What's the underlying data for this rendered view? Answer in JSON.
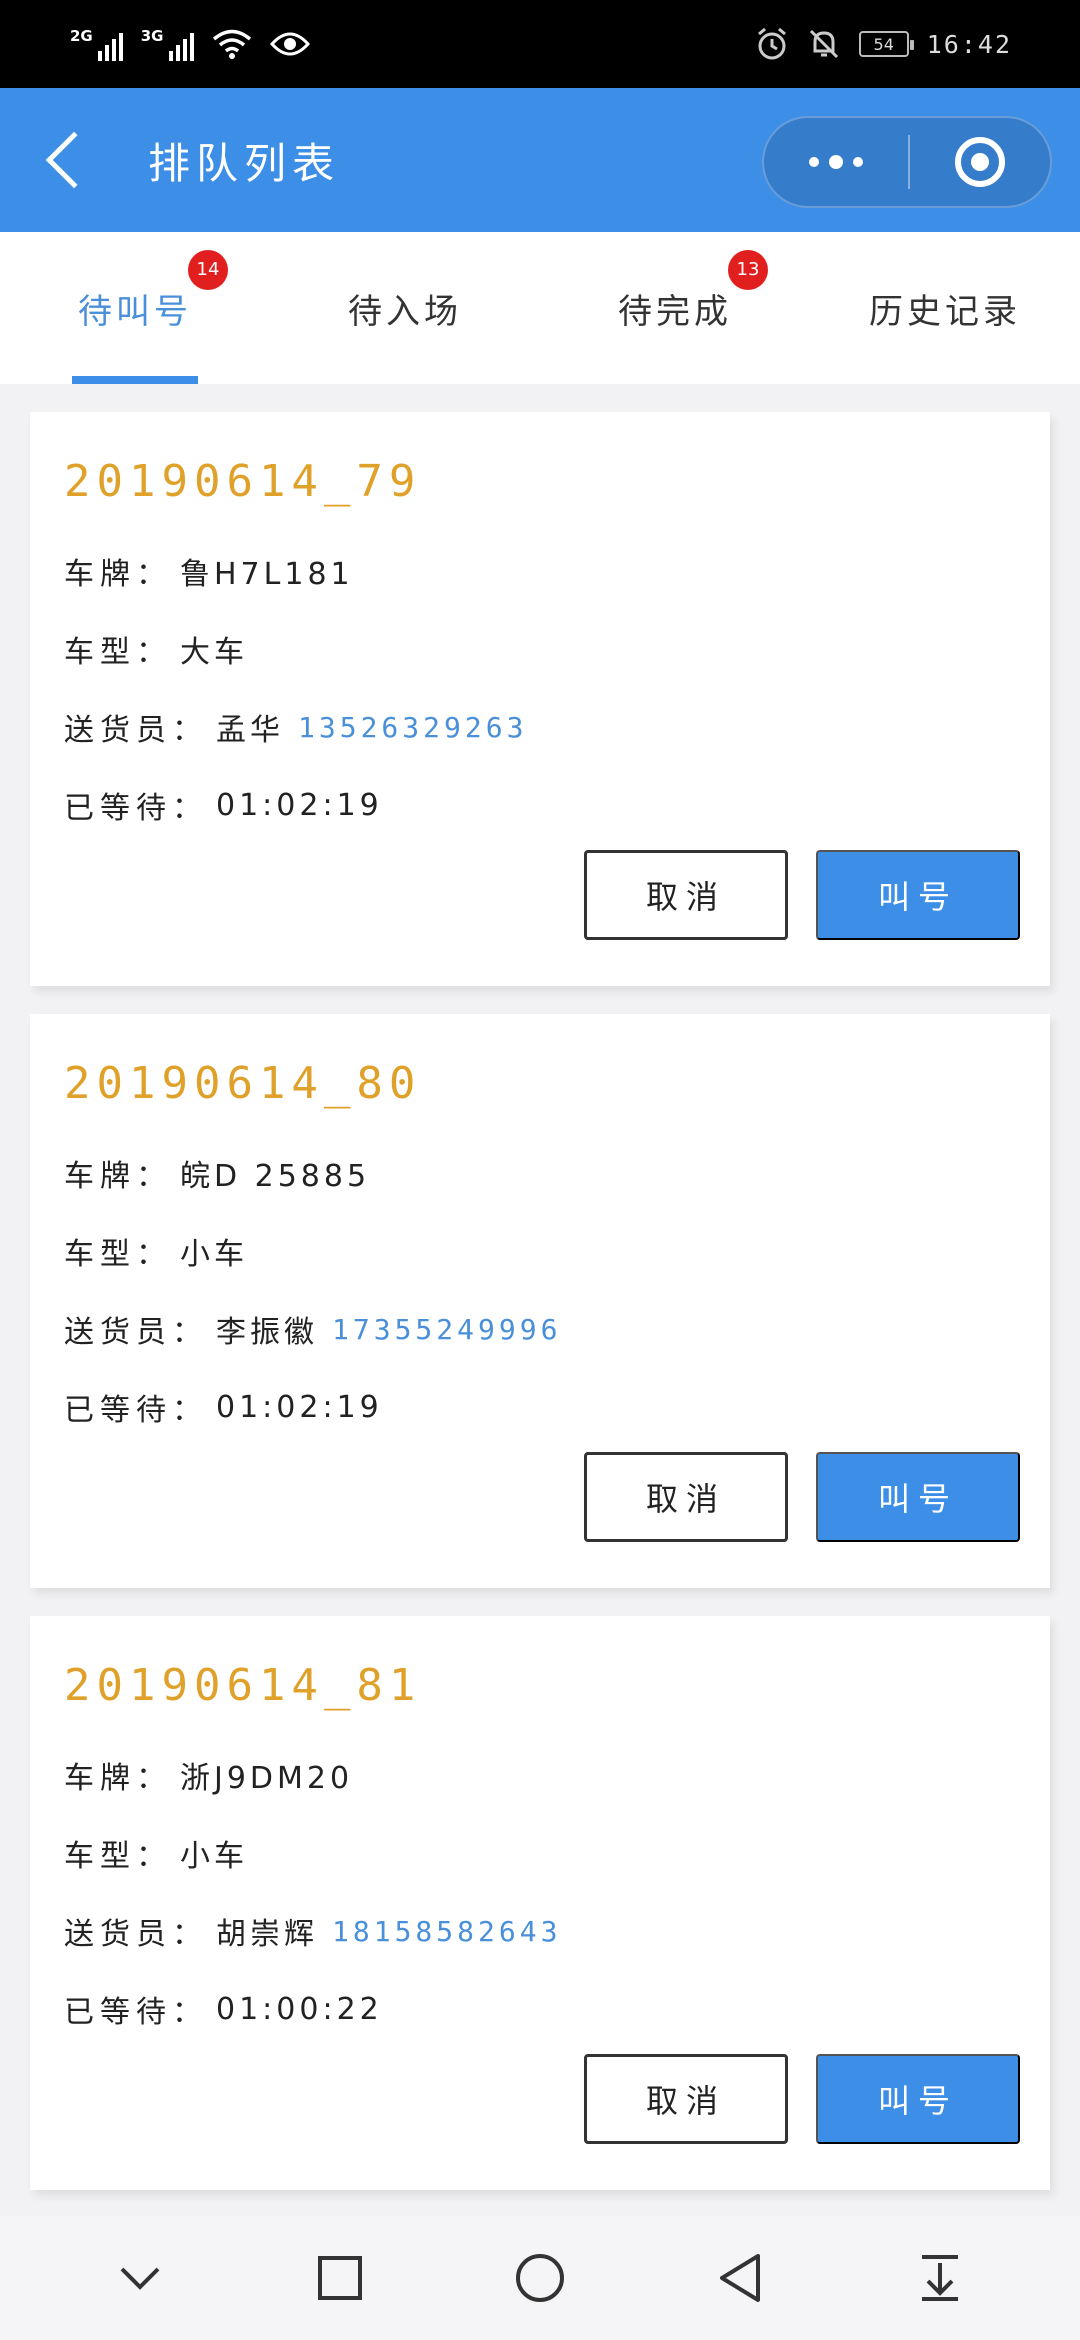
{
  "status_bar": {
    "signal1_label": "2G",
    "signal2_label": "3G",
    "battery": "54",
    "time": "16:42"
  },
  "nav": {
    "title": "排队列表"
  },
  "tabs": [
    {
      "label": "待叫号",
      "badge": "14",
      "active": true
    },
    {
      "label": "待入场",
      "badge": ""
    },
    {
      "label": "待完成",
      "badge": "13"
    },
    {
      "label": "历史记录",
      "badge": ""
    }
  ],
  "cards": [
    {
      "id": "20190614_79",
      "plate_label": "车牌：",
      "plate": "鲁H7L181",
      "type_label": "车型：",
      "type": "大车",
      "courier_label": "送货员：",
      "courier": "孟华",
      "phone": "13526329263",
      "wait_label": "已等待：",
      "wait": "01:02:19",
      "cancel_label": "取消",
      "call_label": "叫号"
    },
    {
      "id": "20190614_80",
      "plate_label": "车牌：",
      "plate": "皖D 25885",
      "type_label": "车型：",
      "type": "小车",
      "courier_label": "送货员：",
      "courier": "李振徽",
      "phone": "17355249996",
      "wait_label": "已等待：",
      "wait": "01:02:19",
      "cancel_label": "取消",
      "call_label": "叫号"
    },
    {
      "id": "20190614_81",
      "plate_label": "车牌：",
      "plate": "浙J9DM20",
      "type_label": "车型：",
      "type": "小车",
      "courier_label": "送货员：",
      "courier": "胡崇辉",
      "phone": "18158582643",
      "wait_label": "已等待：",
      "wait": "01:00:22",
      "cancel_label": "取消",
      "call_label": "叫号"
    }
  ],
  "colors": {
    "primary": "#3d8ee6",
    "card_title": "#e0a12a",
    "phone": "#4a8fd9",
    "badge": "#e21f1f"
  },
  "icons": {
    "back": "chevron-left-icon",
    "more": "more-dots-icon",
    "close": "target-close-icon",
    "sys_nav": [
      "chevron-down-icon",
      "square-icon",
      "circle-icon",
      "triangle-back-icon",
      "download-icon"
    ]
  }
}
